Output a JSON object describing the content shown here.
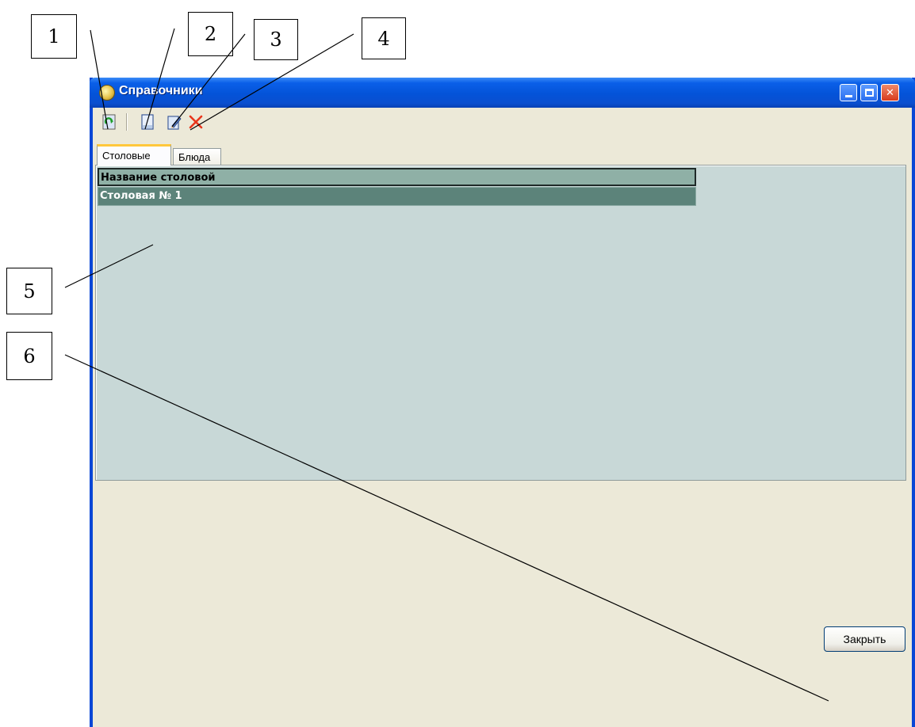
{
  "window": {
    "title": "Справочники",
    "controls": {
      "minimize": "minimize-icon",
      "maximize": "maximize-icon",
      "close": "close-icon"
    }
  },
  "toolbar": {
    "icons": [
      "refresh-icon",
      "new-document-icon",
      "edit-icon",
      "delete-icon"
    ]
  },
  "tabs": [
    {
      "label": "Столовые",
      "active": true
    },
    {
      "label": "Блюда",
      "active": false
    }
  ],
  "grid": {
    "columns": [
      "Название столовой"
    ],
    "rows": [
      [
        "Столовая № 1"
      ]
    ]
  },
  "buttons": {
    "close_label": "Закрыть"
  },
  "callouts": [
    "1",
    "2",
    "3",
    "4",
    "5",
    "6"
  ],
  "colors": {
    "titlebar": "#0453d8",
    "window_bg": "#ece9d8",
    "grid_bg": "#c8d8d7",
    "grid_header_bg": "#8fb0a6",
    "grid_row_bg": "#5c837a",
    "delete_icon": "#e8361c"
  }
}
